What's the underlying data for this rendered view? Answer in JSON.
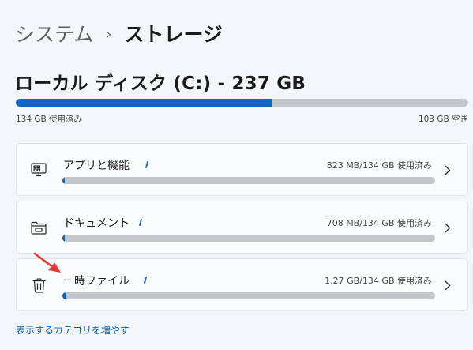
{
  "breadcrumb": {
    "parent": "システム",
    "separator": "›",
    "current": "ストレージ"
  },
  "drive": {
    "title": "ローカル ディスク (C:) - 237 GB",
    "used_label": "134 GB 使用済み",
    "free_label": "103 GB 空き",
    "used_fraction": 0.565
  },
  "categories": [
    {
      "label": "アプリと機能",
      "usage": "823 MB/134 GB 使用済み",
      "fraction": 0.006,
      "icon": "apps-icon"
    },
    {
      "label": "ドキュメント",
      "usage": "708 MB/134 GB 使用済み",
      "fraction": 0.005,
      "icon": "folder-icon"
    },
    {
      "label": "一時ファイル",
      "usage": "1.27 GB/134 GB 使用済み",
      "fraction": 0.009,
      "icon": "trash-icon"
    }
  ],
  "more_link": "表示するカテゴリを増やす",
  "colors": {
    "accent": "#0a67c0",
    "track": "#c3c6ca",
    "annotation_arrow": "#e53935"
  }
}
